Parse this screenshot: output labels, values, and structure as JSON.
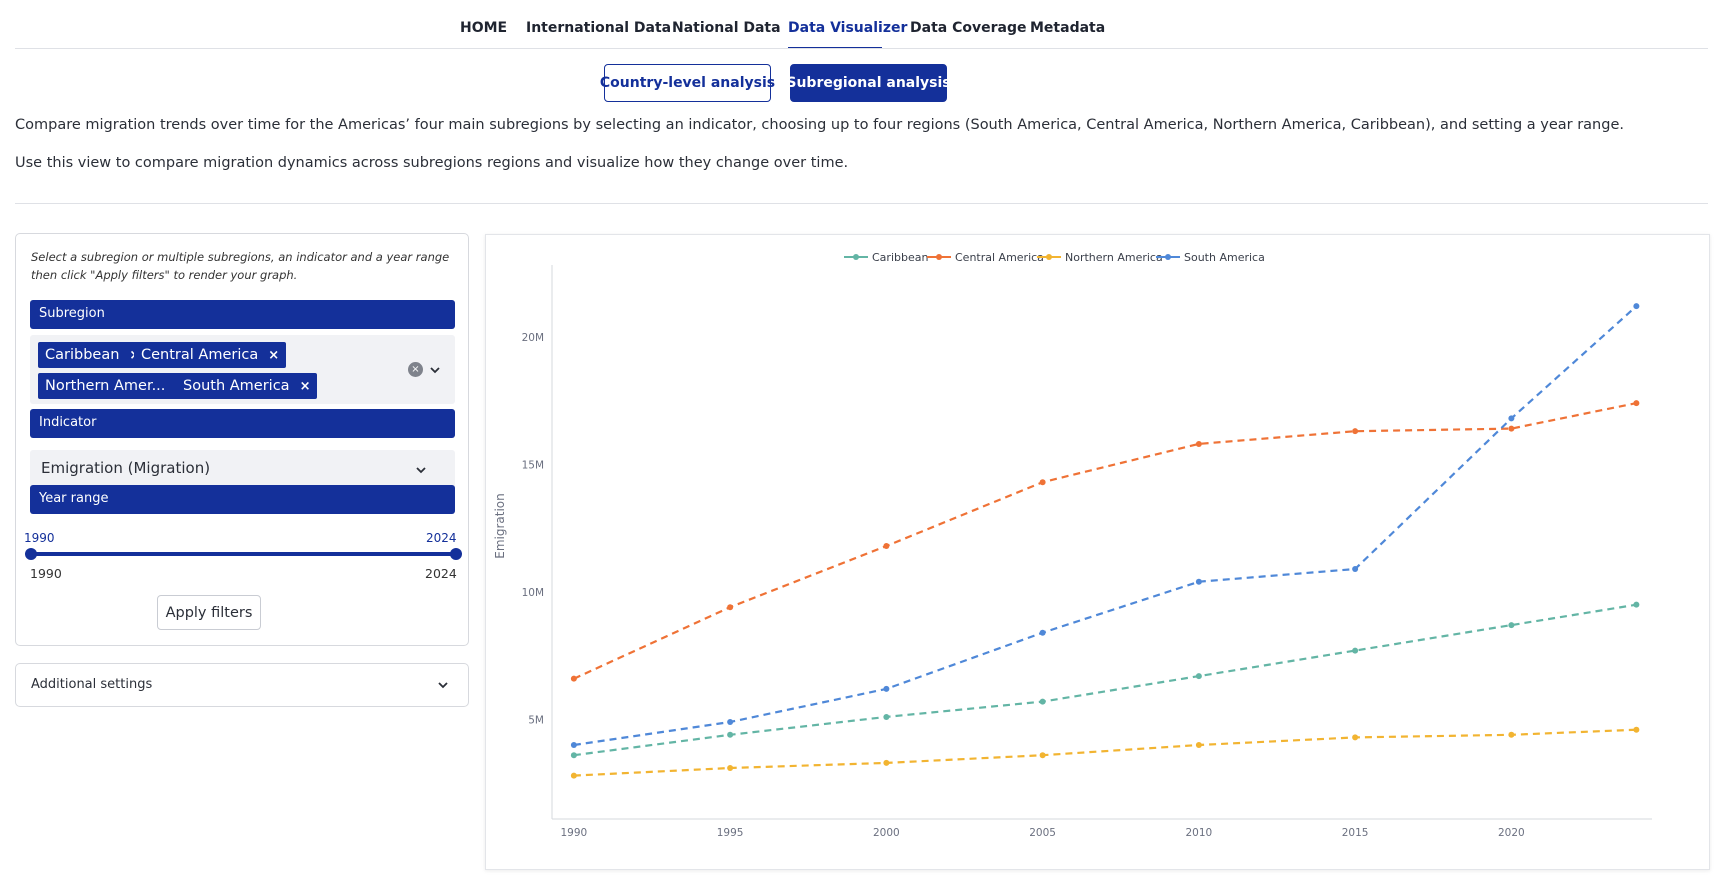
{
  "nav": {
    "items": [
      "HOME",
      "International Data",
      "National Data",
      "Data Visualizer",
      "Data Coverage",
      "Metadata"
    ],
    "active": "Data Visualizer"
  },
  "analysis_toggle": {
    "country_label": "Country-level analysis",
    "subregional_label": "Subregional analysis",
    "selected": "Subregional analysis"
  },
  "intro": {
    "line1": "Compare migration trends over time for the Americas’ four main subregions by selecting an indicator, choosing up to four regions (South America, Central America, Northern America, Caribbean), and setting a year range.",
    "line2": "Use this view to compare migration dynamics across subregions regions and visualize how they change over time."
  },
  "filters": {
    "hint": "Select a subregion or multiple subregions, an indicator and a year range then click \"Apply filters\" to render your graph.",
    "subregion_header": "Subregion",
    "subregion_chips": [
      "Caribbean",
      "Central America",
      "Northern Amer...",
      "South America"
    ],
    "chip_remove": "×",
    "clear_icon": "×",
    "indicator_header": "Indicator",
    "indicator_value": "Emigration (Migration)",
    "year_header": "Year range",
    "year_min": "1990",
    "year_max": "2024",
    "year_min_label": "1990",
    "year_max_label": "2024",
    "apply_label": "Apply filters"
  },
  "additional_settings": {
    "label": "Additional settings"
  },
  "colors": {
    "brand": "#14309a",
    "Caribbean": "#63b5a5",
    "Central America": "#ef7236",
    "Northern America": "#f2b431",
    "South America": "#4f88d8"
  },
  "chart_data": {
    "type": "line",
    "ylabel": "Emigration",
    "xlabel": "",
    "x": [
      1990,
      1995,
      2000,
      2005,
      2010,
      2015,
      2020,
      2024
    ],
    "x_ticks": [
      1990,
      1995,
      2000,
      2005,
      2010,
      2015,
      2020
    ],
    "y_ticks": [
      5000000,
      10000000,
      15000000,
      20000000
    ],
    "y_tick_labels": [
      "5M",
      "10M",
      "15M",
      "20M"
    ],
    "xlim": [
      1989.3,
      2024.5
    ],
    "ylim": [
      1100000,
      22500000
    ],
    "line_style": "dashed",
    "legend_position": "top-center",
    "series": [
      {
        "name": "Caribbean",
        "values": [
          3600000,
          4400000,
          5100000,
          5700000,
          6700000,
          7700000,
          8700000,
          9500000
        ]
      },
      {
        "name": "Central America",
        "values": [
          6600000,
          9400000,
          11800000,
          14300000,
          15800000,
          16300000,
          16400000,
          17400000
        ]
      },
      {
        "name": "Northern America",
        "values": [
          2800000,
          3100000,
          3300000,
          3600000,
          4000000,
          4300000,
          4400000,
          4600000
        ]
      },
      {
        "name": "South America",
        "values": [
          4000000,
          4900000,
          6200000,
          8400000,
          10400000,
          10900000,
          16800000,
          21200000
        ]
      }
    ]
  }
}
